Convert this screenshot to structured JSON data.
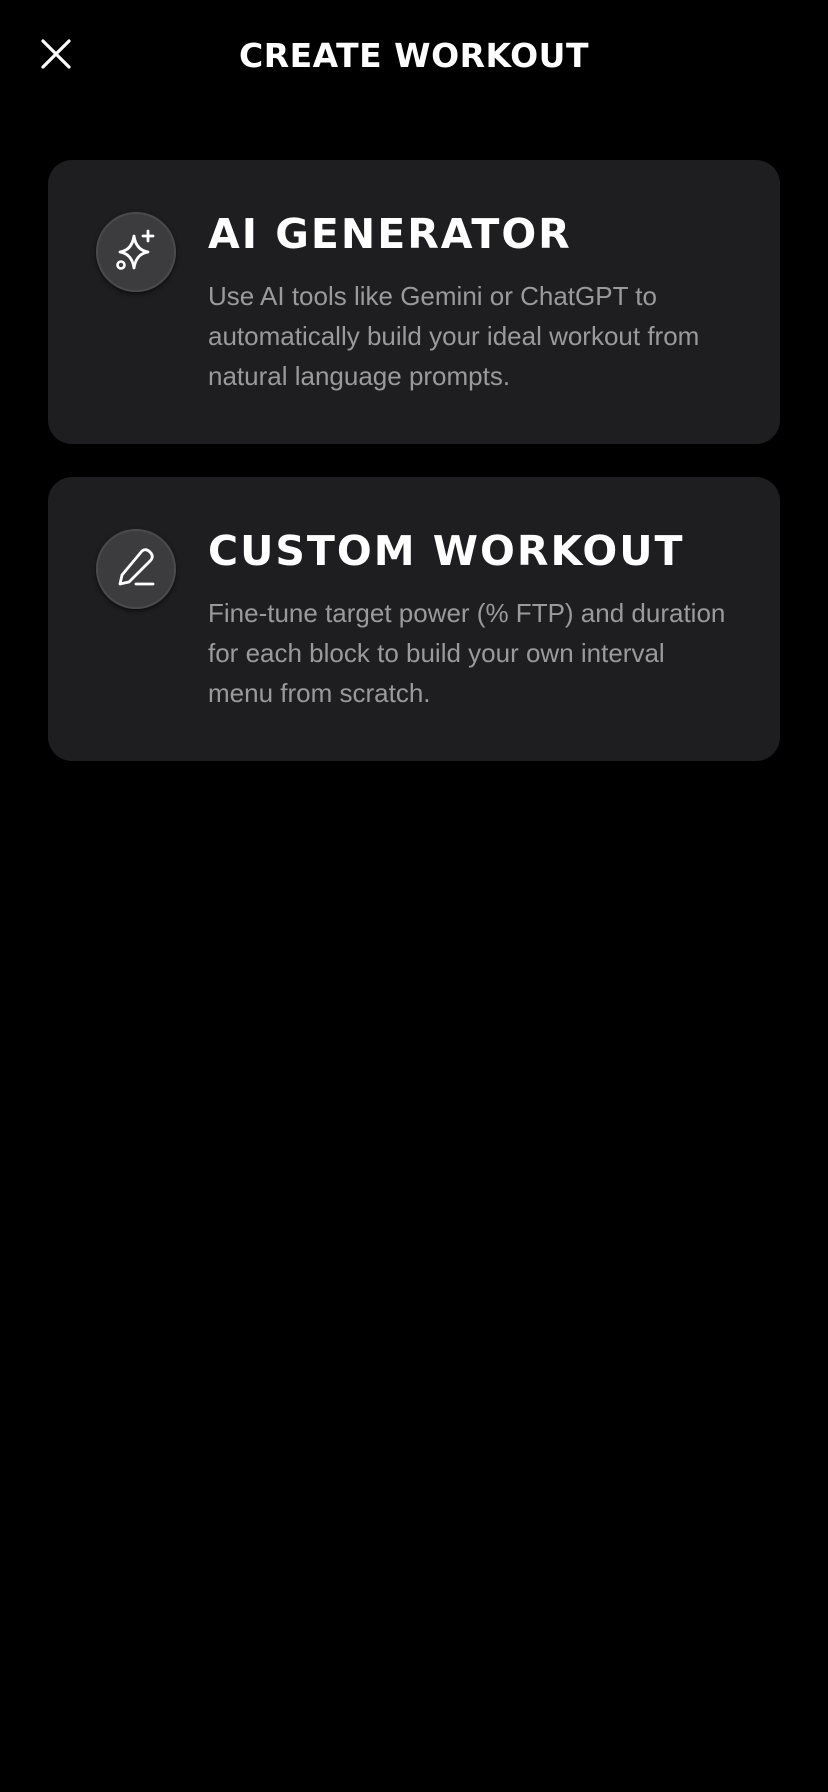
{
  "header": {
    "title": "CREATE WORKOUT",
    "close_icon": "close-icon"
  },
  "cards": [
    {
      "title": "AI GENERATOR",
      "description": "Use AI tools like Gemini or ChatGPT to automatically build your ideal workout from natural language prompts.",
      "icon": "sparkles-icon"
    },
    {
      "title": "CUSTOM WORKOUT",
      "description": "Fine-tune target power (% FTP) and duration for each block to build your own interval menu from scratch.",
      "icon": "pencil-icon"
    }
  ],
  "colors": {
    "background": "#000000",
    "card": "#1e1e20",
    "icon_circle": "#3c3c3e",
    "title": "#ffffff",
    "description": "#9a9a9c"
  }
}
